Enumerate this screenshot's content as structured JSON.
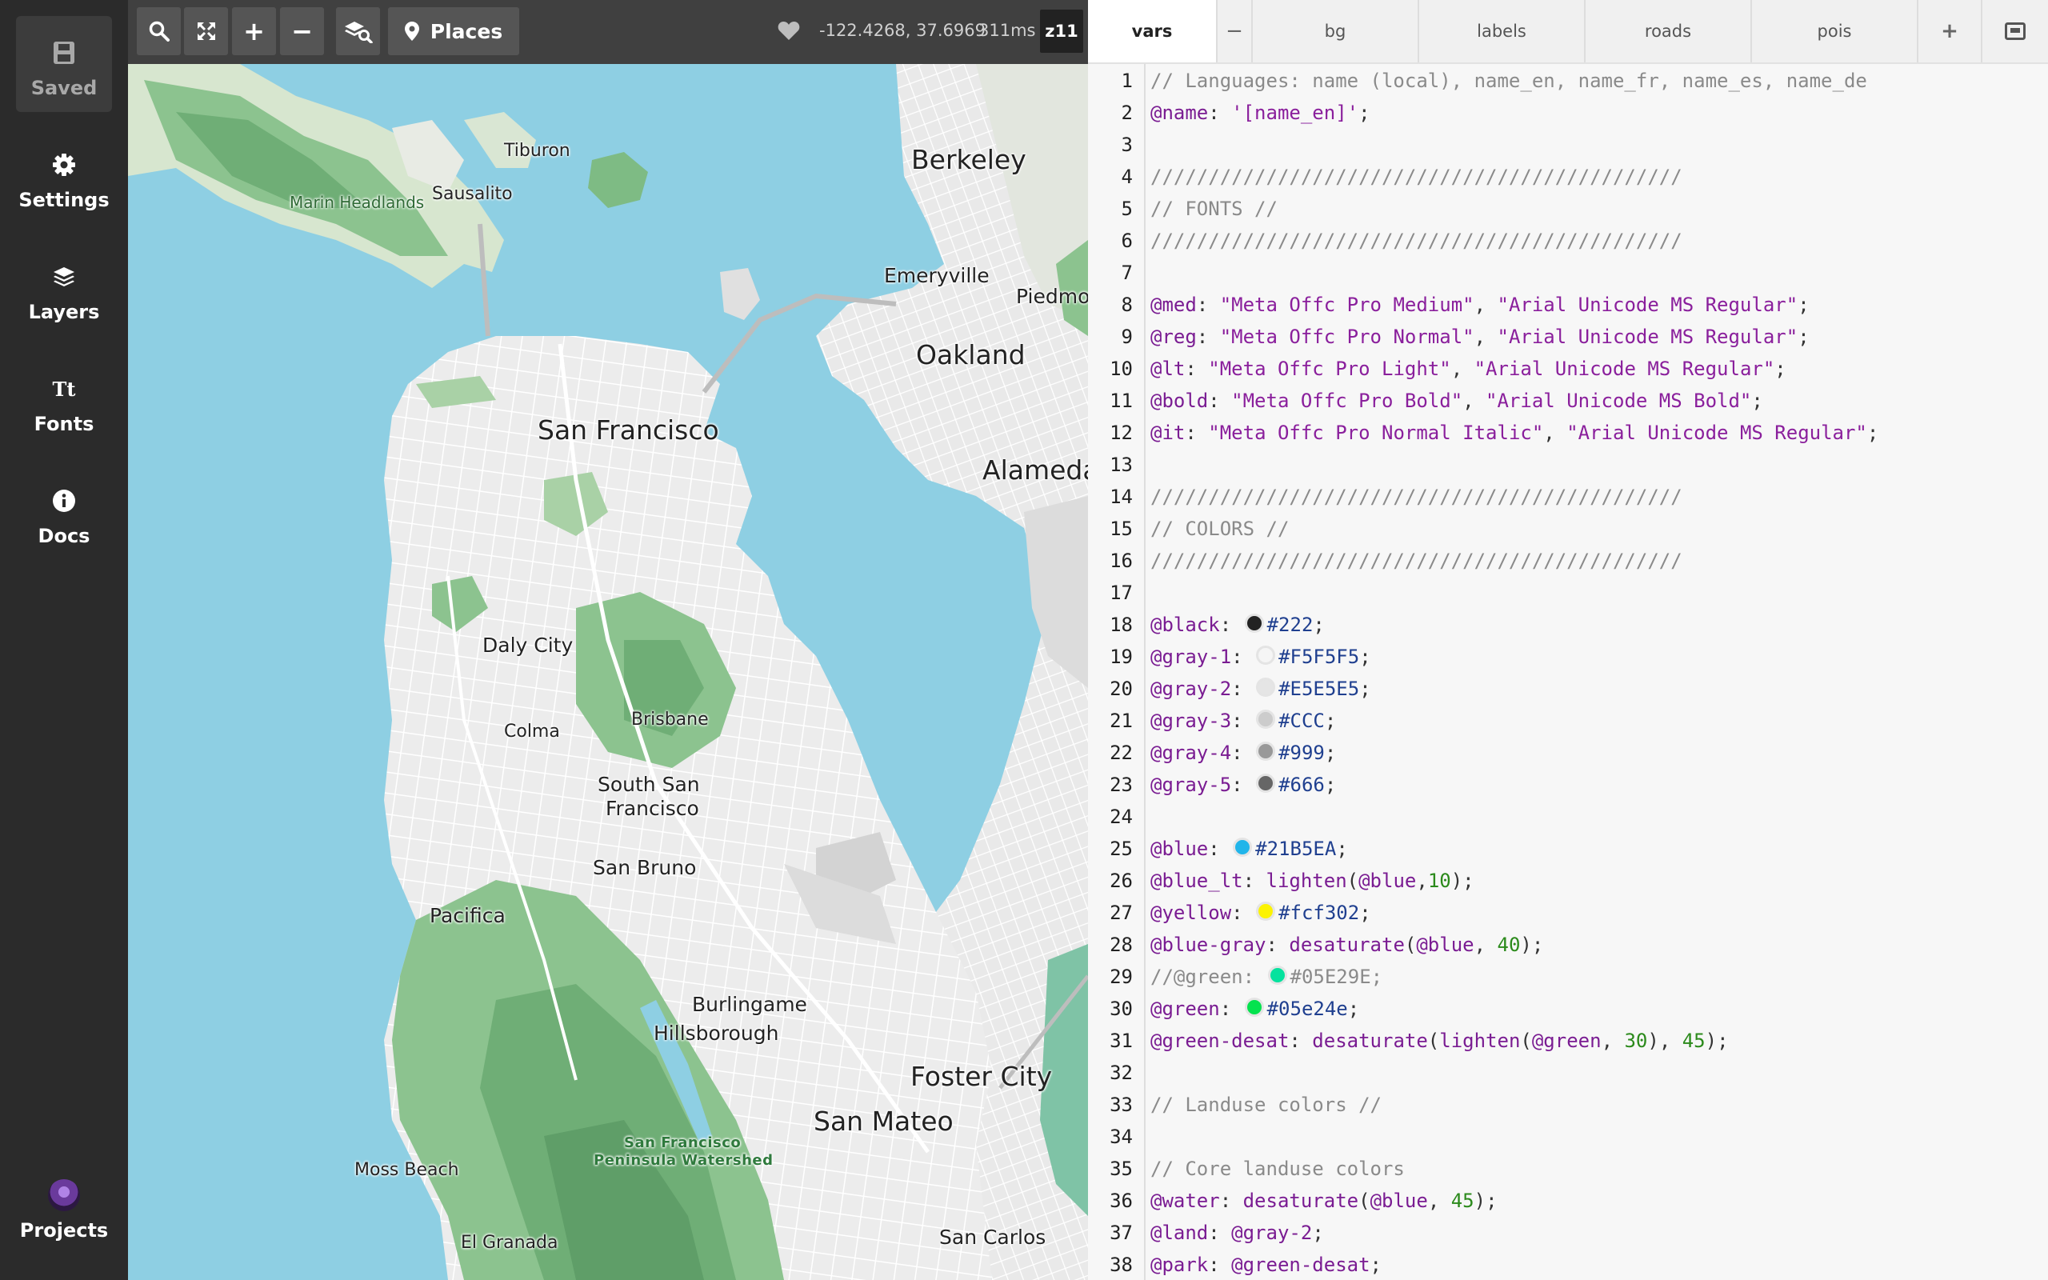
{
  "sidebar": {
    "items": [
      {
        "label": "Saved",
        "icon": "save-icon"
      },
      {
        "label": "Settings",
        "icon": "gear-icon"
      },
      {
        "label": "Layers",
        "icon": "layers-icon"
      },
      {
        "label": "Fonts",
        "icon": "fonts-icon"
      },
      {
        "label": "Docs",
        "icon": "info-icon"
      }
    ],
    "projects_label": "Projects",
    "fonts_glyph": "Tt"
  },
  "toolbar": {
    "places_label": "Places",
    "coordinates": "-122.4268, 37.6969",
    "render_time": "311ms",
    "zoom": "z11",
    "plus": "+",
    "minus": "−"
  },
  "map": {
    "places": [
      {
        "name": "Berkeley",
        "size": "big"
      },
      {
        "name": "Oakland",
        "size": "big"
      },
      {
        "name": "San Francisco",
        "size": "big"
      },
      {
        "name": "Alameda",
        "size": "big"
      },
      {
        "name": "Emeryville",
        "size": "mid"
      },
      {
        "name": "Piedmo",
        "size": "mid"
      },
      {
        "name": "Tiburon",
        "size": "sm"
      },
      {
        "name": "Sausalito",
        "size": "sm"
      },
      {
        "name": "Marin Headlands",
        "size": "sm"
      },
      {
        "name": "Daly City",
        "size": "mid"
      },
      {
        "name": "Colma",
        "size": "sm"
      },
      {
        "name": "Brisbane",
        "size": "sm"
      },
      {
        "name": "South San",
        "size": "mid"
      },
      {
        "name": "Francisco",
        "size": "mid"
      },
      {
        "name": "San Bruno",
        "size": "mid"
      },
      {
        "name": "Pacifica",
        "size": "mid"
      },
      {
        "name": "Burlingame",
        "size": "mid"
      },
      {
        "name": "Hillsborough",
        "size": "mid"
      },
      {
        "name": "Foster City",
        "size": "big"
      },
      {
        "name": "San Mateo",
        "size": "big"
      },
      {
        "name": "San Francisco",
        "size": "green"
      },
      {
        "name": "Peninsula Watershed",
        "size": "green"
      },
      {
        "name": "Moss Beach",
        "size": "sm"
      },
      {
        "name": "El Granada",
        "size": "sm"
      },
      {
        "name": "San Carlos",
        "size": "mid"
      }
    ]
  },
  "tabs": [
    {
      "label": "vars",
      "active": true
    },
    {
      "label": "bg"
    },
    {
      "label": "labels"
    },
    {
      "label": "roads"
    },
    {
      "label": "pois"
    }
  ],
  "tab_controls": {
    "remove": "−",
    "add": "+"
  },
  "code": {
    "swatches": {
      "18": "#222222",
      "19": "#F5F5F5",
      "20": "#E5E5E5",
      "21": "#CCCCCC",
      "22": "#999999",
      "23": "#666666",
      "25": "#21B5EA",
      "27": "#fcf302",
      "29": "#05E29E",
      "30": "#05e24e"
    },
    "lines": [
      "// Languages: name (local), name_en, name_fr, name_es, name_de",
      "@name: '[name_en]';",
      "",
      "//////////////////////////////////////////////",
      "// FONTS //",
      "//////////////////////////////////////////////",
      "",
      "@med: \"Meta Offc Pro Medium\", \"Arial Unicode MS Regular\";",
      "@reg: \"Meta Offc Pro Normal\", \"Arial Unicode MS Regular\";",
      "@lt: \"Meta Offc Pro Light\", \"Arial Unicode MS Regular\";",
      "@bold: \"Meta Offc Pro Bold\", \"Arial Unicode MS Bold\";",
      "@it: \"Meta Offc Pro Normal Italic\", \"Arial Unicode MS Regular\";",
      "",
      "//////////////////////////////////////////////",
      "// COLORS //",
      "//////////////////////////////////////////////",
      "",
      "@black: #222;",
      "@gray-1: #F5F5F5;",
      "@gray-2: #E5E5E5;",
      "@gray-3: #CCC;",
      "@gray-4: #999;",
      "@gray-5: #666;",
      "",
      "@blue: #21B5EA;",
      "@blue_lt: lighten(@blue,10);",
      "@yellow: #fcf302;",
      "@blue-gray: desaturate(@blue, 40);",
      "//@green: #05E29E;",
      "@green: #05e24e;",
      "@green-desat: desaturate(lighten(@green, 30), 45);",
      "",
      "// Landuse colors //",
      "",
      "// Core landuse colors",
      "@water: desaturate(@blue, 45);",
      "@land: @gray-2;",
      "@park: @green-desat;"
    ]
  }
}
